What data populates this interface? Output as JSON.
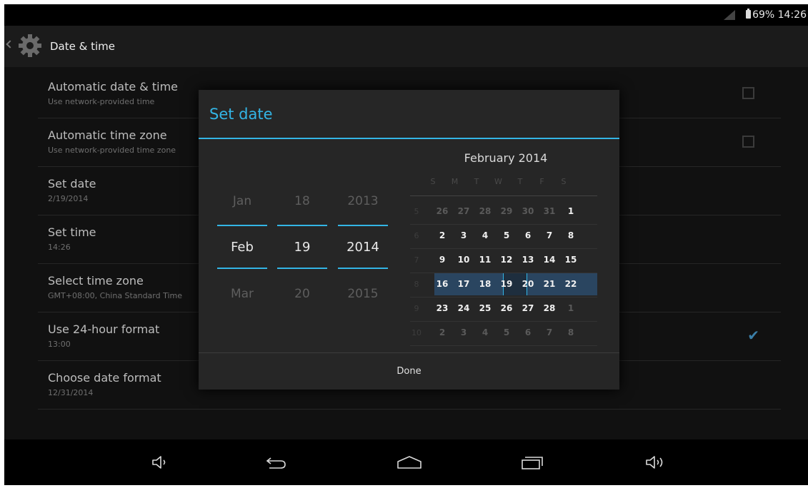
{
  "status": {
    "battery": "69%",
    "time": "14:26"
  },
  "app": {
    "title": "Date & time"
  },
  "settings": [
    {
      "title": "Automatic date & time",
      "summary": "Use network-provided time",
      "control": "checkbox",
      "checked": false
    },
    {
      "title": "Automatic time zone",
      "summary": "Use network-provided time zone",
      "control": "checkbox",
      "checked": false
    },
    {
      "title": "Set date",
      "summary": "2/19/2014"
    },
    {
      "title": "Set time",
      "summary": "14:26"
    },
    {
      "title": "Select time zone",
      "summary": "GMT+08:00, China Standard Time"
    },
    {
      "title": "Use 24-hour format",
      "summary": "13:00",
      "control": "checkbox",
      "checked": true
    },
    {
      "title": "Choose date format",
      "summary": "12/31/2014"
    }
  ],
  "dialog": {
    "title": "Set date",
    "spinners": [
      {
        "name": "month",
        "prev": "Jan",
        "current": "Feb",
        "next": "Mar"
      },
      {
        "name": "day",
        "prev": "18",
        "current": "19",
        "next": "20"
      },
      {
        "name": "year",
        "prev": "2013",
        "current": "2014",
        "next": "2015"
      }
    ],
    "calendar": {
      "month_label": "February 2014",
      "weekdays": [
        "S",
        "M",
        "T",
        "W",
        "T",
        "F",
        "S"
      ],
      "weeks": [
        {
          "num": "5",
          "days": [
            {
              "d": "26",
              "s": "out"
            },
            {
              "d": "27",
              "s": "out"
            },
            {
              "d": "28",
              "s": "out"
            },
            {
              "d": "29",
              "s": "out"
            },
            {
              "d": "30",
              "s": "out"
            },
            {
              "d": "31",
              "s": "out"
            },
            {
              "d": "1",
              "s": "in"
            }
          ]
        },
        {
          "num": "6",
          "days": [
            {
              "d": "2",
              "s": "in"
            },
            {
              "d": "3",
              "s": "in"
            },
            {
              "d": "4",
              "s": "in"
            },
            {
              "d": "5",
              "s": "in"
            },
            {
              "d": "6",
              "s": "in"
            },
            {
              "d": "7",
              "s": "in"
            },
            {
              "d": "8",
              "s": "in"
            }
          ]
        },
        {
          "num": "7",
          "days": [
            {
              "d": "9",
              "s": "in"
            },
            {
              "d": "10",
              "s": "in"
            },
            {
              "d": "11",
              "s": "in"
            },
            {
              "d": "12",
              "s": "in"
            },
            {
              "d": "13",
              "s": "in"
            },
            {
              "d": "14",
              "s": "in"
            },
            {
              "d": "15",
              "s": "in"
            }
          ]
        },
        {
          "num": "8",
          "days": [
            {
              "d": "16",
              "s": "in"
            },
            {
              "d": "17",
              "s": "in"
            },
            {
              "d": "18",
              "s": "in"
            },
            {
              "d": "19",
              "s": "selected"
            },
            {
              "d": "20",
              "s": "in"
            },
            {
              "d": "21",
              "s": "in"
            },
            {
              "d": "22",
              "s": "in"
            }
          ]
        },
        {
          "num": "9",
          "days": [
            {
              "d": "23",
              "s": "in"
            },
            {
              "d": "24",
              "s": "in"
            },
            {
              "d": "25",
              "s": "in"
            },
            {
              "d": "26",
              "s": "in"
            },
            {
              "d": "27",
              "s": "in"
            },
            {
              "d": "28",
              "s": "in"
            },
            {
              "d": "1",
              "s": "out"
            }
          ]
        },
        {
          "num": "10",
          "days": [
            {
              "d": "2",
              "s": "out"
            },
            {
              "d": "3",
              "s": "out"
            },
            {
              "d": "4",
              "s": "out"
            },
            {
              "d": "5",
              "s": "out"
            },
            {
              "d": "6",
              "s": "out"
            },
            {
              "d": "7",
              "s": "out"
            },
            {
              "d": "8",
              "s": "out"
            }
          ]
        }
      ]
    },
    "done_label": "Done"
  },
  "nav": [
    "volume-down-icon",
    "back-icon",
    "home-icon",
    "recent-apps-icon",
    "volume-up-icon"
  ],
  "colors": {
    "accent": "#33b5e5",
    "selected_week": "#2a4560",
    "dialog_bg": "#262626"
  }
}
